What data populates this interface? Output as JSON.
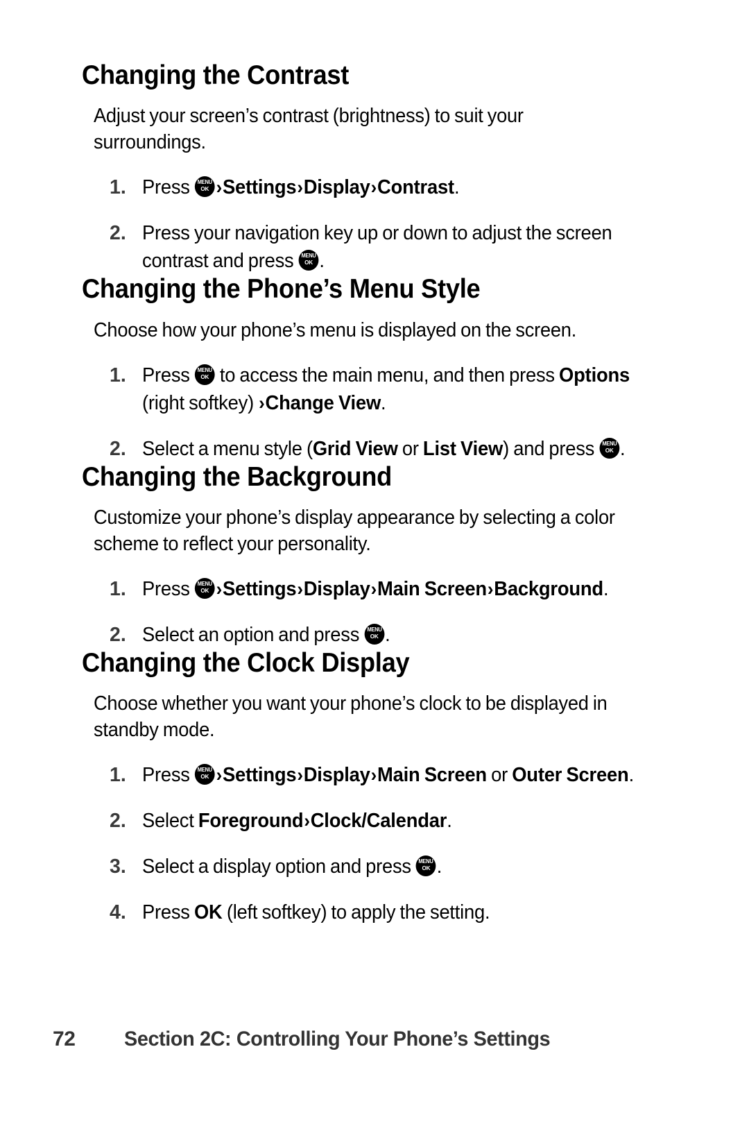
{
  "document": {
    "page_number": "72",
    "footer_title": "Section 2C: Controlling Your Phone’s Settings",
    "key_icon": {
      "name": "menu-ok-key-icon",
      "top_label": "MENU",
      "bottom_label": "OK"
    },
    "chevron": "›"
  },
  "sections": [
    {
      "heading": "Changing the Contrast",
      "intro": "Adjust your screen’s contrast (brightness) to suit your surroundings.",
      "steps": [
        {
          "num": "1.",
          "parts": [
            {
              "type": "text",
              "value": "Press "
            },
            {
              "type": "key"
            },
            {
              "type": "chevron"
            },
            {
              "type": "bold",
              "value": "Settings"
            },
            {
              "type": "chevron"
            },
            {
              "type": "bold",
              "value": "Display"
            },
            {
              "type": "chevron"
            },
            {
              "type": "bold",
              "value": "Contrast"
            },
            {
              "type": "text",
              "value": "."
            }
          ]
        },
        {
          "num": "2.",
          "parts": [
            {
              "type": "text",
              "value": "Press your navigation key up or down to adjust the screen contrast and press "
            },
            {
              "type": "key"
            },
            {
              "type": "text",
              "value": "."
            }
          ]
        }
      ]
    },
    {
      "heading": "Changing the Phone’s Menu Style",
      "intro": "Choose how your phone’s menu is displayed on the screen.",
      "steps": [
        {
          "num": "1.",
          "parts": [
            {
              "type": "text",
              "value": "Press "
            },
            {
              "type": "key"
            },
            {
              "type": "text",
              "value": " to access the main menu, and then press "
            },
            {
              "type": "bold",
              "value": "Options"
            },
            {
              "type": "text",
              "value": " (right softkey) "
            },
            {
              "type": "chevron"
            },
            {
              "type": "bold",
              "value": "Change View"
            },
            {
              "type": "text",
              "value": "."
            }
          ]
        },
        {
          "num": "2.",
          "parts": [
            {
              "type": "text",
              "value": "Select a menu style ("
            },
            {
              "type": "bold",
              "value": "Grid View"
            },
            {
              "type": "text",
              "value": " or "
            },
            {
              "type": "bold",
              "value": "List View"
            },
            {
              "type": "text",
              "value": ") and press "
            },
            {
              "type": "key"
            },
            {
              "type": "text",
              "value": "."
            }
          ]
        }
      ]
    },
    {
      "heading": "Changing the Background",
      "intro": "Customize your phone’s display appearance by selecting a color scheme to reflect your personality.",
      "steps": [
        {
          "num": "1.",
          "parts": [
            {
              "type": "text",
              "value": "Press "
            },
            {
              "type": "key"
            },
            {
              "type": "chevron"
            },
            {
              "type": "bold",
              "value": "Settings"
            },
            {
              "type": "chevron"
            },
            {
              "type": "bold",
              "value": "Display"
            },
            {
              "type": "chevron"
            },
            {
              "type": "bold",
              "value": "Main Screen"
            },
            {
              "type": "chevron"
            },
            {
              "type": "bold",
              "value": "Background"
            },
            {
              "type": "text",
              "value": "."
            }
          ]
        },
        {
          "num": "2.",
          "parts": [
            {
              "type": "text",
              "value": "Select an option and press "
            },
            {
              "type": "key"
            },
            {
              "type": "text",
              "value": "."
            }
          ]
        }
      ]
    },
    {
      "heading": "Changing the Clock Display",
      "intro": "Choose whether you want your phone’s clock to be displayed in standby mode.",
      "steps": [
        {
          "num": "1.",
          "parts": [
            {
              "type": "text",
              "value": "Press "
            },
            {
              "type": "key"
            },
            {
              "type": "chevron"
            },
            {
              "type": "bold",
              "value": "Settings"
            },
            {
              "type": "chevron"
            },
            {
              "type": "bold",
              "value": "Display"
            },
            {
              "type": "chevron"
            },
            {
              "type": "bold",
              "value": "Main Screen"
            },
            {
              "type": "text",
              "value": " or "
            },
            {
              "type": "bold",
              "value": "Outer Screen"
            },
            {
              "type": "text",
              "value": "."
            }
          ]
        },
        {
          "num": "2.",
          "parts": [
            {
              "type": "text",
              "value": "Select "
            },
            {
              "type": "bold",
              "value": "Foreground"
            },
            {
              "type": "chevron"
            },
            {
              "type": "bold",
              "value": "Clock/Calendar"
            },
            {
              "type": "text",
              "value": "."
            }
          ]
        },
        {
          "num": "3.",
          "parts": [
            {
              "type": "text",
              "value": "Select a display option and press "
            },
            {
              "type": "key"
            },
            {
              "type": "text",
              "value": "."
            }
          ]
        },
        {
          "num": "4.",
          "parts": [
            {
              "type": "text",
              "value": "Press "
            },
            {
              "type": "bold",
              "value": "OK"
            },
            {
              "type": "text",
              "value": " (left softkey) to apply the setting."
            }
          ]
        }
      ]
    }
  ]
}
